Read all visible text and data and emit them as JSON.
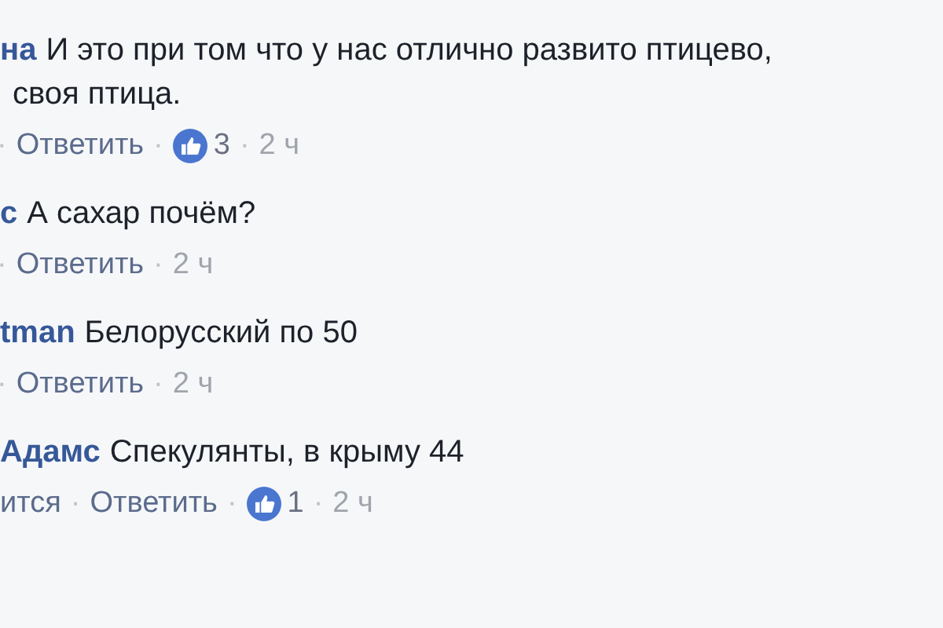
{
  "comments": [
    {
      "author": "на",
      "lines": [
        "И это при том что у нас отлично развито птицево,",
        "своя птица."
      ],
      "actions": [
        {
          "kind": "sep",
          "text": "·"
        },
        {
          "kind": "link",
          "text": "Ответить"
        },
        {
          "kind": "sep",
          "text": "·"
        },
        {
          "kind": "reactions",
          "text": "3"
        },
        {
          "kind": "sep",
          "text": "·"
        },
        {
          "kind": "time",
          "text": "2 ч"
        }
      ]
    },
    {
      "author": "с",
      "lines": [
        "А сахар почём?"
      ],
      "actions": [
        {
          "kind": "sep",
          "text": "·"
        },
        {
          "kind": "link",
          "text": "Ответить"
        },
        {
          "kind": "sep",
          "text": "·"
        },
        {
          "kind": "time",
          "text": "2 ч"
        }
      ]
    },
    {
      "author": "tman",
      "lines": [
        "Белорусский по 50"
      ],
      "actions": [
        {
          "kind": "sep",
          "text": "·"
        },
        {
          "kind": "link",
          "text": "Ответить"
        },
        {
          "kind": "sep",
          "text": "·"
        },
        {
          "kind": "time",
          "text": "2 ч"
        }
      ]
    },
    {
      "author": "Адамс",
      "lines": [
        "Спекулянты, в крыму 44"
      ],
      "actions": [
        {
          "kind": "link",
          "text": "ится"
        },
        {
          "kind": "sep",
          "text": "·"
        },
        {
          "kind": "link",
          "text": "Ответить"
        },
        {
          "kind": "sep",
          "text": "·"
        },
        {
          "kind": "reactions",
          "text": "1"
        },
        {
          "kind": "sep",
          "text": "·"
        },
        {
          "kind": "time",
          "text": "2 ч"
        }
      ]
    }
  ]
}
